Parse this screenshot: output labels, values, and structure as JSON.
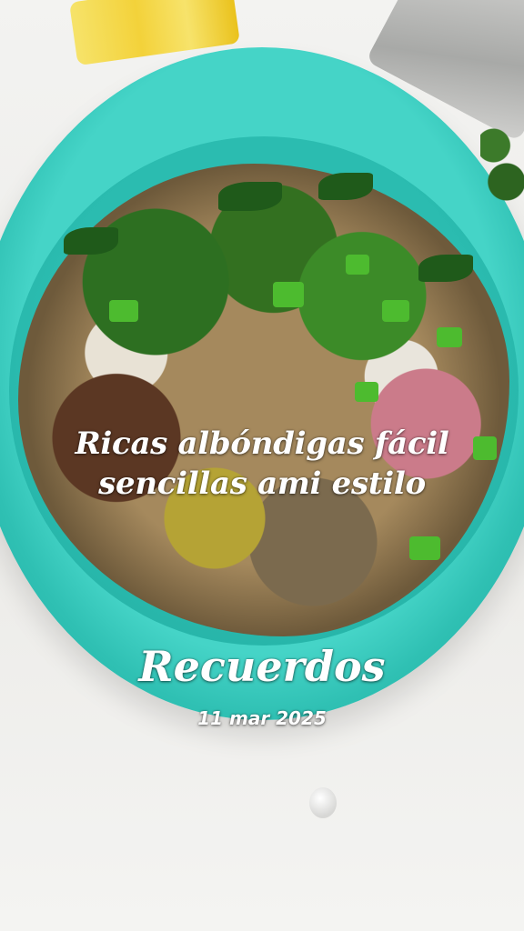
{
  "overlay": {
    "headline_line1": "Ricas albóndigas fácil",
    "headline_line2": "sencillas ami estilo",
    "title": "Recuerdos",
    "date": "11 mar 2025"
  },
  "colors": {
    "bowl": "#2fc0b3",
    "text": "#ffffff"
  }
}
